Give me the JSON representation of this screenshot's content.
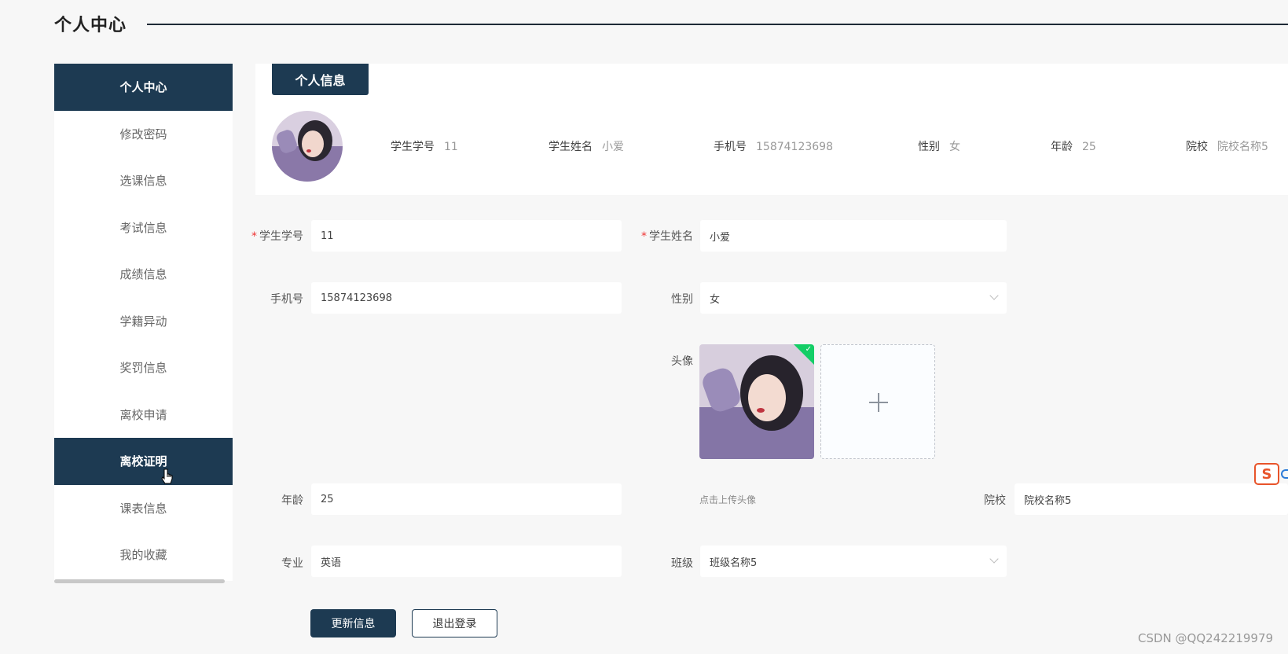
{
  "header": {
    "title": "个人中心"
  },
  "sidebar": {
    "items": [
      {
        "label": "个人中心",
        "active": true
      },
      {
        "label": "修改密码"
      },
      {
        "label": "选课信息"
      },
      {
        "label": "考试信息"
      },
      {
        "label": "成绩信息"
      },
      {
        "label": "学籍异动"
      },
      {
        "label": "奖罚信息"
      },
      {
        "label": "离校申请"
      },
      {
        "label": "离校证明",
        "active": true
      },
      {
        "label": "课表信息"
      },
      {
        "label": "我的收藏"
      }
    ]
  },
  "card": {
    "tab_label": "个人信息",
    "summary": [
      {
        "key": "学生学号",
        "value": "11"
      },
      {
        "key": "学生姓名",
        "value": "小爱"
      },
      {
        "key": "手机号",
        "value": "15874123698"
      },
      {
        "key": "性别",
        "value": "女"
      },
      {
        "key": "年龄",
        "value": "25"
      },
      {
        "key": "院校",
        "value": "院校名称5"
      }
    ]
  },
  "form": {
    "student_id": {
      "label": "学生学号",
      "value": "11"
    },
    "student_name": {
      "label": "学生姓名",
      "value": "小爱"
    },
    "phone": {
      "label": "手机号",
      "value": "15874123698"
    },
    "gender": {
      "label": "性别",
      "value": "女"
    },
    "avatar": {
      "label": "头像",
      "hint": "点击上传头像"
    },
    "age": {
      "label": "年龄",
      "value": "25"
    },
    "school": {
      "label": "院校",
      "value": "院校名称5"
    },
    "major": {
      "label": "专业",
      "value": "英语"
    },
    "class": {
      "label": "班级",
      "value": "班级名称5"
    },
    "update_button": "更新信息",
    "logout_button": "退出登录"
  },
  "watermark": "CSDN @QQ242219979",
  "float_icon_letter": "S",
  "colors": {
    "primary": "#1d3a52",
    "required": "#e33333",
    "success": "#13ce66"
  }
}
